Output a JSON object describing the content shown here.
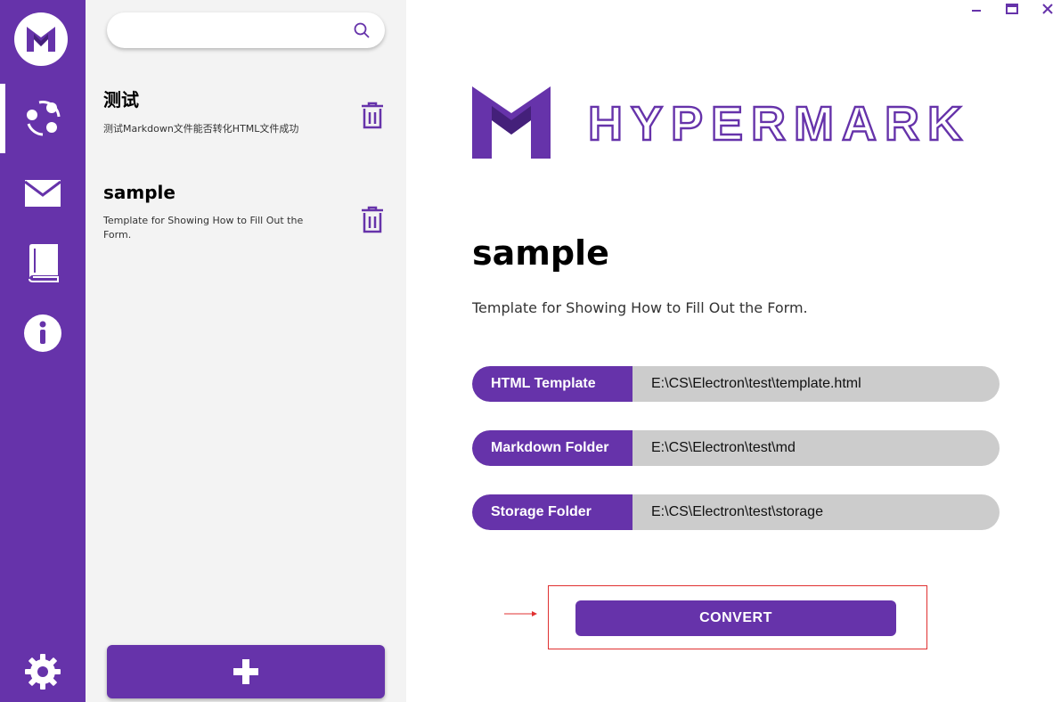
{
  "window": {
    "minimize_icon": "minimize-icon",
    "maximize_icon": "maximize-icon",
    "close_icon": "close-icon"
  },
  "nav": {
    "logo": "M",
    "items": [
      {
        "id": "templates",
        "icon": "share-nodes-icon",
        "active": true
      },
      {
        "id": "mail",
        "icon": "mail-icon",
        "active": false
      },
      {
        "id": "book",
        "icon": "book-icon",
        "active": false
      },
      {
        "id": "info",
        "icon": "info-icon",
        "active": false
      }
    ],
    "settings_icon": "gear-icon"
  },
  "search": {
    "value": "",
    "placeholder": ""
  },
  "templates": [
    {
      "title": "测试",
      "description": "测试Markdown文件能否转化HTML文件成功"
    },
    {
      "title": "sample",
      "description": "Template for Showing How to Fill Out the Form."
    }
  ],
  "add_button_icon": "plus-icon",
  "brand": {
    "name": "HYPERMARK"
  },
  "detail": {
    "title": "sample",
    "description": "Template for Showing How to Fill Out the Form.",
    "fields": [
      {
        "label": "HTML Template",
        "value": "E:\\CS\\Electron\\test\\template.html"
      },
      {
        "label": "Markdown Folder",
        "value": "E:\\CS\\Electron\\test\\md"
      },
      {
        "label": "Storage Folder",
        "value": "E:\\CS\\Electron\\test\\storage"
      }
    ],
    "convert_label": "CONVERT"
  },
  "colors": {
    "accent": "#6633AA",
    "panel_bg": "#f3f3f3",
    "field_bg": "#cccccc",
    "annotation": "#e03030"
  }
}
